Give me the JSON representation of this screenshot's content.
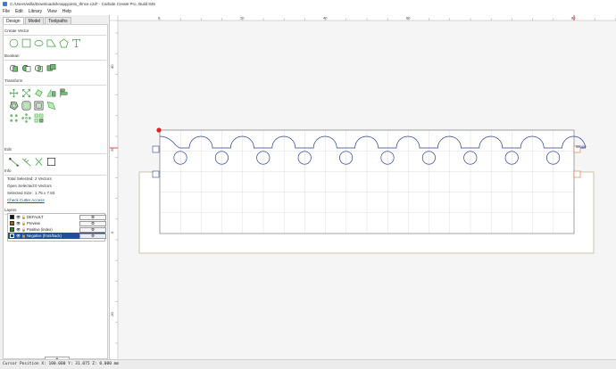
{
  "window": {
    "title": "C:/Users/willa/Downloads/knappjoints_thrice.c2d* - Carbide Create Pro, Build 845"
  },
  "menu": [
    "File",
    "Edit",
    "Library",
    "View",
    "Help"
  ],
  "tabs": [
    "Design",
    "Model",
    "Toolpaths"
  ],
  "sections": {
    "create_vector": "Create Vector",
    "boolean": "Boolean",
    "transform": "Transform",
    "edit": "Edit",
    "info": "Info",
    "layers": "Layers"
  },
  "info": {
    "total_selected": "Total Selected:",
    "total_selected_value": "2 Vectors",
    "open_selected": "Open Selected:",
    "open_selected_value": "0 Vectors",
    "selected_size": "Selected Size:",
    "selected_size_value": "1.75 x 7.83",
    "check_cutter_access": "Check Cutter Access"
  },
  "layers": [
    {
      "name": "DEFAULT",
      "color": "#111111",
      "selected": false
    },
    {
      "name": "Preview",
      "color": "#8a6d10",
      "selected": false
    },
    {
      "name": "Positive (index)",
      "color": "#2e7d32",
      "selected": false
    },
    {
      "name": "Negative (front/back)",
      "color": "#1f3f8a",
      "selected": true
    }
  ],
  "add_layer_label": "+",
  "ruler": {
    "top_labels": [
      "0",
      "20",
      "40",
      "60",
      "80"
    ],
    "left_labels": [
      "40",
      "20",
      "0",
      "-20"
    ]
  },
  "canvas_label": "Wope",
  "status": {
    "cursor": "Cursor Position X: 100.000 Y: 31.075 Z: 0.000 mm"
  },
  "colors": {
    "icon_green": "#3aa63a",
    "vector_blue": "#2b3f9e",
    "stock_olive": "#b5b08a",
    "grid_line": "#dcdcdc",
    "selection_blue": "#1f4e9c"
  }
}
